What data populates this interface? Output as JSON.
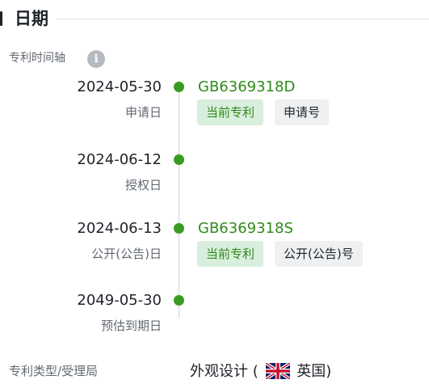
{
  "section": {
    "title": "日期"
  },
  "timeline": {
    "label": "专利时间轴",
    "info_icon": "info-icon",
    "events": [
      {
        "date": "2024-05-30",
        "caption": "申请日",
        "number": "GB6369318D",
        "tags": [
          "当前专利",
          "申请号"
        ]
      },
      {
        "date": "2024-06-12",
        "caption": "授权日"
      },
      {
        "date": "2024-06-13",
        "caption": "公开(公告)日",
        "number": "GB6369318S",
        "tags": [
          "当前专利",
          "公开(公告)号"
        ]
      },
      {
        "date": "2049-05-30",
        "caption": "预估到期日"
      }
    ]
  },
  "patent_type": {
    "label": "专利类型/受理局",
    "value": "外观设计",
    "open_paren": "(",
    "flag_icon": "uk-flag-icon",
    "country": "英国",
    "close_paren": ")"
  },
  "colors": {
    "accent_green": "#3a9a22",
    "tag_green_bg": "#d9eedd",
    "tag_gray_bg": "#eff0f1"
  }
}
